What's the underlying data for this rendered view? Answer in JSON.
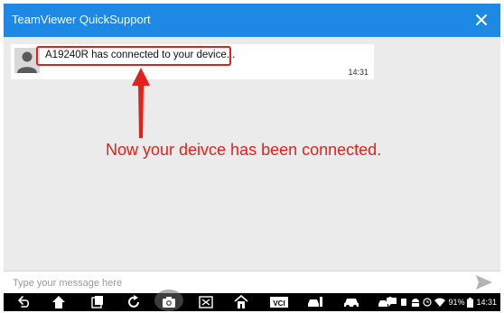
{
  "app": {
    "title": "TeamViewer QuickSupport"
  },
  "chat": {
    "messages": [
      {
        "text": "A19240R has connected to your device...",
        "time": "14:31"
      }
    ]
  },
  "annotation": {
    "text": "Now your deivce has been connected."
  },
  "input": {
    "placeholder": "Type your message here"
  },
  "status_bar": {
    "battery": "91%",
    "time": "14:31"
  },
  "navbar": {
    "icons": [
      "back-icon",
      "home-icon",
      "recent-apps-icon",
      "refresh-icon",
      "camera-icon",
      "screenshot-icon",
      "house-icon",
      "vci-icon",
      "car-diagnose-icon",
      "car-icon",
      "car-tools-icon"
    ]
  },
  "colors": {
    "titlebar": "#1e88e5",
    "annotation": "#e3211b",
    "background": "#ebebeb"
  }
}
